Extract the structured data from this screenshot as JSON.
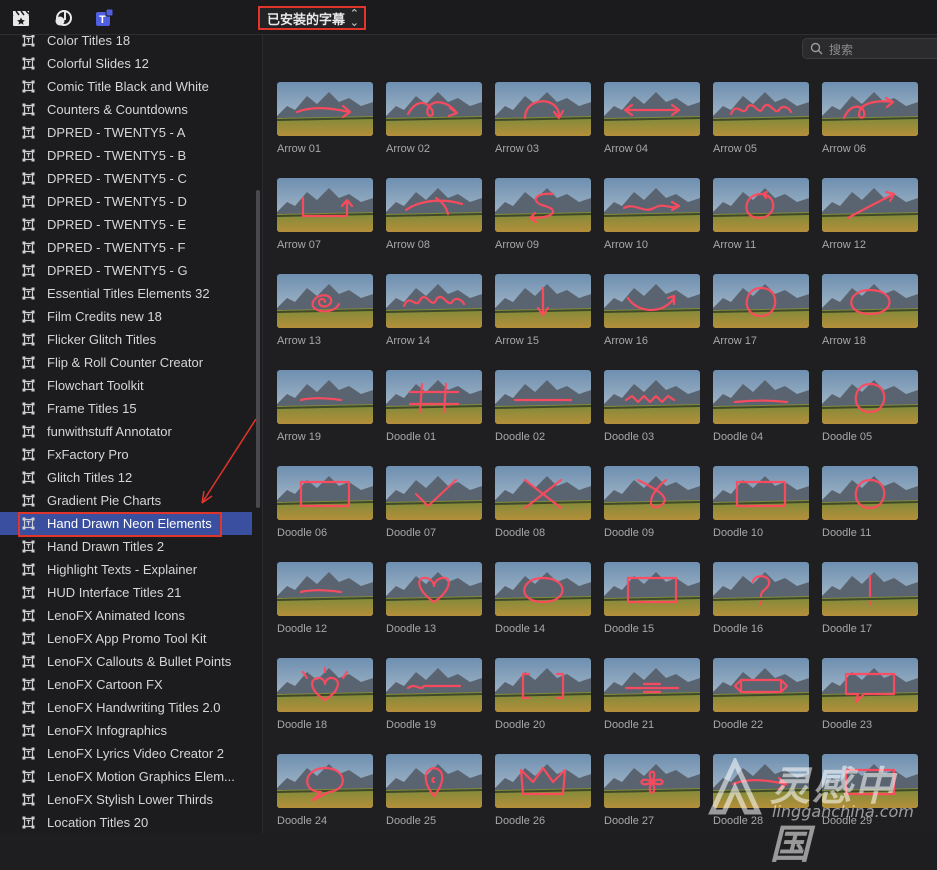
{
  "toolbar": {
    "icons": [
      "clapper-icon",
      "music-photos-icon",
      "titles-generators-icon"
    ],
    "browser_selector": "已安装的字幕"
  },
  "search": {
    "placeholder": "搜索"
  },
  "sidebar": {
    "selected_index": 21,
    "items": [
      "Color Titles 18",
      "Colorful Slides 12",
      "Comic Title Black and White",
      "Counters & Countdowns",
      "DPRED - TWENTY5 - A",
      "DPRED - TWENTY5 - B",
      "DPRED - TWENTY5 - C",
      "DPRED - TWENTY5 - D",
      "DPRED - TWENTY5 - E",
      "DPRED - TWENTY5 - F",
      "DPRED - TWENTY5 - G",
      "Essential Titles Elements 32",
      "Film Credits new 18",
      "Flicker Glitch Titles",
      "Flip & Roll Counter Creator",
      "Flowchart Toolkit",
      "Frame Titles 15",
      "funwithstuff Annotator",
      "FxFactory Pro",
      "Glitch Titles 12",
      "Gradient Pie Charts",
      "Hand Drawn Neon Elements",
      "Hand Drawn Titles 2",
      "Highlight Texts - Explainer",
      "HUD Interface Titles 21",
      "LenoFX Animated Icons",
      "LenoFX App Promo Tool Kit",
      "LenoFX Callouts & Bullet Points",
      "LenoFX Cartoon FX",
      "LenoFX Handwriting Titles 2.0",
      "LenoFX Infographics",
      "LenoFX Lyrics Video Creator 2",
      "LenoFX Motion Graphics Elem...",
      "LenoFX Stylish Lower Thirds",
      "Location Titles 20"
    ]
  },
  "grid": {
    "items": [
      {
        "label": "Arrow 01",
        "shape": "arrow-right"
      },
      {
        "label": "Arrow 02",
        "shape": "loop-arrow"
      },
      {
        "label": "Arrow 03",
        "shape": "arch"
      },
      {
        "label": "Arrow 04",
        "shape": "double-arrow"
      },
      {
        "label": "Arrow 05",
        "shape": "loops"
      },
      {
        "label": "Arrow 06",
        "shape": "curl-arrow"
      },
      {
        "label": "Arrow 07",
        "shape": "u-arrow"
      },
      {
        "label": "Arrow 08",
        "shape": "swoosh"
      },
      {
        "label": "Arrow 09",
        "shape": "s-curve"
      },
      {
        "label": "Arrow 10",
        "shape": "wave-arrow"
      },
      {
        "label": "Arrow 11",
        "shape": "circle-arrow"
      },
      {
        "label": "Arrow 12",
        "shape": "diag-arrow"
      },
      {
        "label": "Arrow 13",
        "shape": "spiral"
      },
      {
        "label": "Arrow 14",
        "shape": "loops"
      },
      {
        "label": "Arrow 15",
        "shape": "down-arrow"
      },
      {
        "label": "Arrow 16",
        "shape": "smile-arrow"
      },
      {
        "label": "Arrow 17",
        "shape": "circle"
      },
      {
        "label": "Arrow 18",
        "shape": "ellipse"
      },
      {
        "label": "Arrow 19",
        "shape": "short-line"
      },
      {
        "label": "Doodle 01",
        "shape": "hash"
      },
      {
        "label": "Doodle 02",
        "shape": "line"
      },
      {
        "label": "Doodle 03",
        "shape": "zigzag"
      },
      {
        "label": "Doodle 04",
        "shape": "underline"
      },
      {
        "label": "Doodle 05",
        "shape": "circle"
      },
      {
        "label": "Doodle 06",
        "shape": "rect"
      },
      {
        "label": "Doodle 07",
        "shape": "check"
      },
      {
        "label": "Doodle 08",
        "shape": "x-mark"
      },
      {
        "label": "Doodle 09",
        "shape": "x-loop"
      },
      {
        "label": "Doodle 10",
        "shape": "rect"
      },
      {
        "label": "Doodle 11",
        "shape": "circle"
      },
      {
        "label": "Doodle 12",
        "shape": "short-line"
      },
      {
        "label": "Doodle 13",
        "shape": "heart"
      },
      {
        "label": "Doodle 14",
        "shape": "ellipse"
      },
      {
        "label": "Doodle 15",
        "shape": "rect"
      },
      {
        "label": "Doodle 16",
        "shape": "question"
      },
      {
        "label": "Doodle 17",
        "shape": "exclaim"
      },
      {
        "label": "Doodle 18",
        "shape": "heart-burst"
      },
      {
        "label": "Doodle 19",
        "shape": "swirl-line"
      },
      {
        "label": "Doodle 20",
        "shape": "brackets"
      },
      {
        "label": "Doodle 21",
        "shape": "ribbon"
      },
      {
        "label": "Doodle 22",
        "shape": "banner"
      },
      {
        "label": "Doodle 23",
        "shape": "speech"
      },
      {
        "label": "Doodle 24",
        "shape": "speech-round"
      },
      {
        "label": "Doodle 25",
        "shape": "pin"
      },
      {
        "label": "Doodle 26",
        "shape": "crown"
      },
      {
        "label": "Doodle 27",
        "shape": "flower"
      },
      {
        "label": "Doodle 28",
        "shape": "arrow-right"
      },
      {
        "label": "Doodle 29",
        "shape": "rect"
      }
    ]
  },
  "colors": {
    "accent": "#3a4fa0",
    "highlight_box": "#e0352a",
    "neon": "#ff4a5e"
  },
  "watermark": {
    "line1": "灵感中国",
    "line2": "lingganchina.com"
  }
}
